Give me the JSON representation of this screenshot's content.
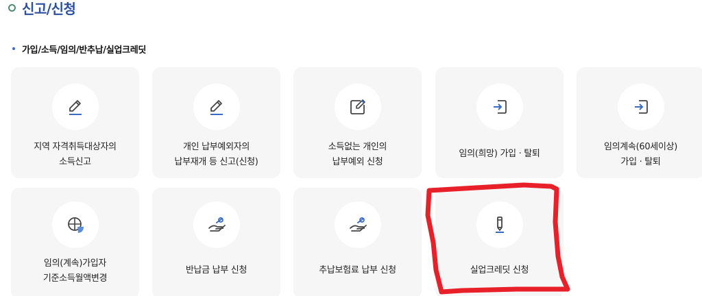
{
  "page": {
    "title": "신고/신청"
  },
  "section": {
    "title": "가입/소득/임의/반추납/실업크레딧"
  },
  "cards": [
    {
      "line1": "지역 자격취득대상자의",
      "line2": "소득신고",
      "icon": "pencil-icon"
    },
    {
      "line1": "개인 납부예외자의",
      "line2": "납부재개 등 신고(신청)",
      "icon": "pencil-icon"
    },
    {
      "line1": "소득없는 개인의",
      "line2": "납부예외 신청",
      "icon": "edit-box-icon"
    },
    {
      "line1": "임의(희망) 가입 · 탈퇴",
      "line2": "",
      "icon": "login-icon"
    },
    {
      "line1": "임의계속(60세이상)",
      "line2": "가입 · 탈퇴",
      "icon": "login-icon"
    },
    {
      "line1": "임의(계속)가입자",
      "line2": "기준소득월액변경",
      "icon": "globe-pie-icon"
    },
    {
      "line1": "반납금 납부 신청",
      "line2": "",
      "icon": "hand-coin-icon"
    },
    {
      "line1": "추납보험료 납부 신청",
      "line2": "",
      "icon": "hand-coin-icon"
    },
    {
      "line1": "실업크레딧 신청",
      "line2": "",
      "icon": "pen-icon"
    }
  ],
  "colors": {
    "title": "#2a4fa0",
    "accent": "#3a6bc4",
    "highlight": "#e8202a",
    "card_bg": "#f6f6f6"
  }
}
